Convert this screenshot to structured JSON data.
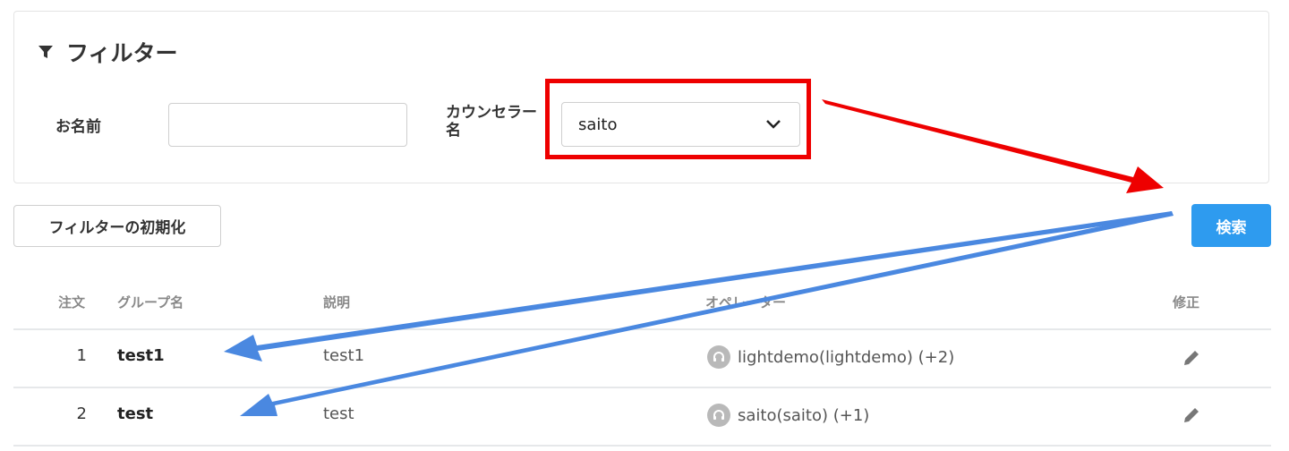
{
  "filter": {
    "title": "フィルター",
    "name_label": "お名前",
    "name_value": "",
    "counselor_label": "カウンセラー名",
    "counselor_value": "saito"
  },
  "buttons": {
    "reset_label": "フィルターの初期化",
    "search_label": "検索"
  },
  "table": {
    "headers": {
      "order": "注文",
      "group": "グループ名",
      "description": "説明",
      "operator": "オペレーター",
      "edit": "修正"
    },
    "rows": [
      {
        "order": "1",
        "group": "test1",
        "description": "test1",
        "operator": "lightdemo(lightdemo) (+2)"
      },
      {
        "order": "2",
        "group": "test",
        "description": "test",
        "operator": "saito(saito) (+1)"
      }
    ]
  },
  "colors": {
    "accent": "#2e9bef",
    "highlight_box": "#ee0000",
    "arrow_red": "#ee0000",
    "arrow_blue": "#4a88e0"
  }
}
